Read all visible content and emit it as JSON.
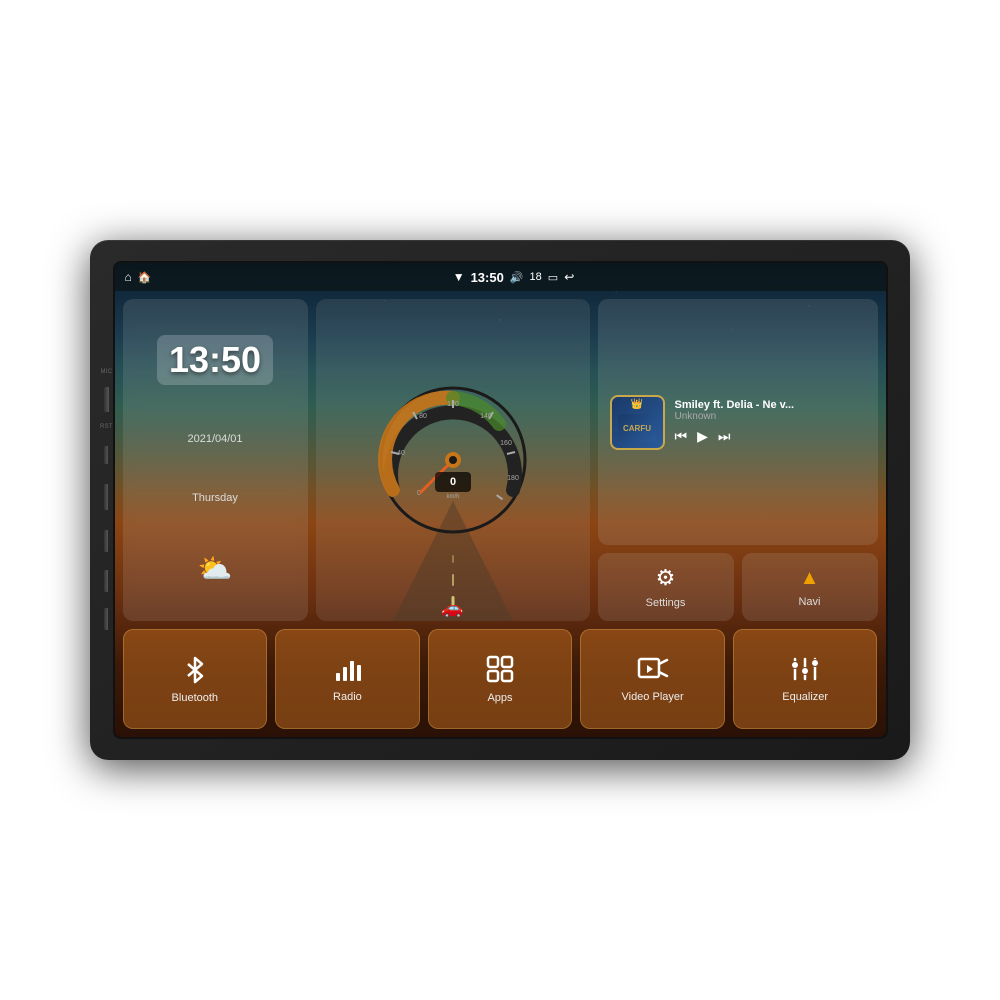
{
  "device": {
    "mic_label": "MIC",
    "rst_label": "RST"
  },
  "status_bar": {
    "home_icon": "⌂",
    "house_icon": "🏠",
    "wifi_icon": "▼",
    "time": "13:50",
    "volume_icon": "🔊",
    "volume_level": "18",
    "battery_icon": "🔋",
    "back_icon": "↩"
  },
  "clock": {
    "time": "13:50",
    "date": "2021/04/01",
    "day": "Thursday",
    "weather_icon": "⛅"
  },
  "speedometer": {
    "speed": "0",
    "unit": "km/h",
    "max": "220"
  },
  "music": {
    "title": "Smiley ft. Delia - Ne v...",
    "artist": "Unknown",
    "logo_text": "CARFU",
    "prev_icon": "⏮",
    "play_icon": "▶",
    "next_icon": "⏭"
  },
  "quick_buttons": [
    {
      "id": "settings",
      "icon": "⚙",
      "label": "Settings"
    },
    {
      "id": "navi",
      "icon": "▲",
      "label": "Navi"
    }
  ],
  "app_buttons": [
    {
      "id": "bluetooth",
      "icon": "✦",
      "label": "Bluetooth"
    },
    {
      "id": "radio",
      "icon": "📊",
      "label": "Radio"
    },
    {
      "id": "apps",
      "icon": "⊞",
      "label": "Apps"
    },
    {
      "id": "video",
      "icon": "▶",
      "label": "Video Player"
    },
    {
      "id": "equalizer",
      "icon": "🎚",
      "label": "Equalizer"
    }
  ],
  "side_controls": [
    {
      "id": "home",
      "icon": "⌂"
    },
    {
      "id": "back",
      "icon": "↩"
    },
    {
      "id": "vol-up",
      "icon": "🔊+"
    },
    {
      "id": "vol-down",
      "icon": "🔊-"
    }
  ]
}
